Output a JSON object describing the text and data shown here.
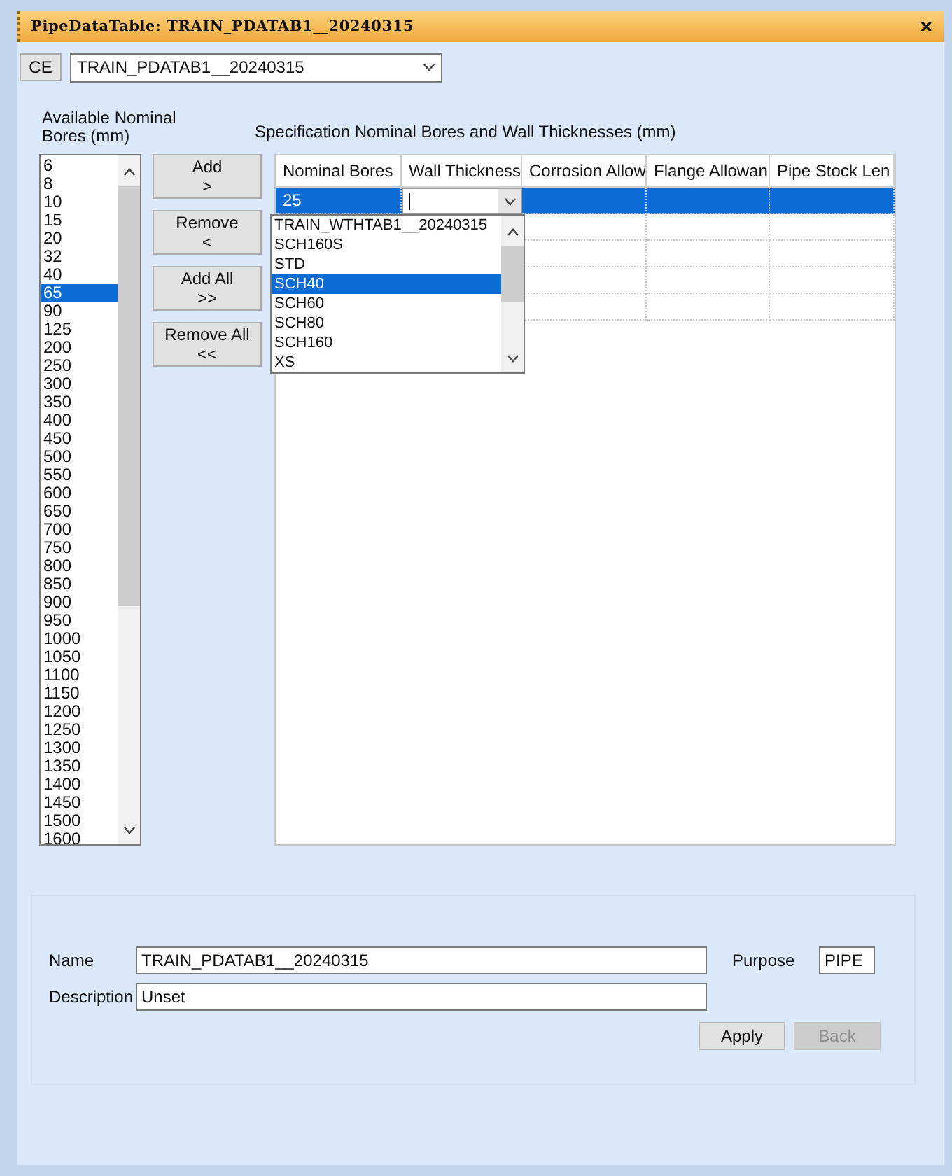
{
  "window": {
    "title": "PipeDataTable: TRAIN_PDATAB1__20240315",
    "close": "×"
  },
  "ce_button": "CE",
  "table_selector": {
    "value": "TRAIN_PDATAB1__20240315"
  },
  "available_label": "Available Nominal Bores (mm)",
  "available_bores": [
    {
      "label": "6",
      "selected": false
    },
    {
      "label": "8",
      "selected": false
    },
    {
      "label": "10",
      "selected": false
    },
    {
      "label": "15",
      "selected": false
    },
    {
      "label": "20",
      "selected": false
    },
    {
      "label": "32",
      "selected": false
    },
    {
      "label": "40",
      "selected": false
    },
    {
      "label": "65",
      "selected": true
    },
    {
      "label": "90",
      "selected": false
    },
    {
      "label": "125",
      "selected": false
    },
    {
      "label": "200",
      "selected": false
    },
    {
      "label": "250",
      "selected": false
    },
    {
      "label": "300",
      "selected": false
    },
    {
      "label": "350",
      "selected": false
    },
    {
      "label": "400",
      "selected": false
    },
    {
      "label": "450",
      "selected": false
    },
    {
      "label": "500",
      "selected": false
    },
    {
      "label": "550",
      "selected": false
    },
    {
      "label": "600",
      "selected": false
    },
    {
      "label": "650",
      "selected": false
    },
    {
      "label": "700",
      "selected": false
    },
    {
      "label": "750",
      "selected": false
    },
    {
      "label": "800",
      "selected": false
    },
    {
      "label": "850",
      "selected": false
    },
    {
      "label": "900",
      "selected": false
    },
    {
      "label": "950",
      "selected": false
    },
    {
      "label": "1000",
      "selected": false
    },
    {
      "label": "1050",
      "selected": false
    },
    {
      "label": "1100",
      "selected": false
    },
    {
      "label": "1150",
      "selected": false
    },
    {
      "label": "1200",
      "selected": false
    },
    {
      "label": "1250",
      "selected": false
    },
    {
      "label": "1300",
      "selected": false
    },
    {
      "label": "1350",
      "selected": false
    },
    {
      "label": "1400",
      "selected": false
    },
    {
      "label": "1450",
      "selected": false
    },
    {
      "label": "1500",
      "selected": false
    },
    {
      "label": "1600",
      "selected": false
    }
  ],
  "move_buttons": [
    {
      "label": "Add",
      "arrow": ">"
    },
    {
      "label": "Remove",
      "arrow": "<"
    },
    {
      "label": "Add All",
      "arrow": ">>"
    },
    {
      "label": "Remove All",
      "arrow": "<<"
    }
  ],
  "spec_label": "Specification Nominal Bores and Wall Thicknesses (mm)",
  "table": {
    "columns": [
      "Nominal Bores",
      "Wall Thickness",
      "Corrosion Allow",
      "Flange Allowan",
      "Pipe Stock Len"
    ],
    "rows": [
      {
        "nominal_bore": "25",
        "selected": true,
        "editing": true
      },
      {
        "selected": false
      },
      {
        "selected": false
      },
      {
        "selected": false
      },
      {
        "selected": false
      }
    ]
  },
  "wall_thickness_dropdown": {
    "options": [
      {
        "label": "TRAIN_WTHTAB1__20240315",
        "selected": false
      },
      {
        "label": "SCH160S",
        "selected": false
      },
      {
        "label": "STD",
        "selected": false
      },
      {
        "label": "SCH40",
        "selected": true
      },
      {
        "label": "SCH60",
        "selected": false
      },
      {
        "label": "SCH80",
        "selected": false
      },
      {
        "label": "SCH160",
        "selected": false
      },
      {
        "label": "XS",
        "selected": false
      }
    ]
  },
  "form": {
    "name_label": "Name",
    "name": "TRAIN_PDATAB1__20240315",
    "purpose_label": "Purpose",
    "purpose": "PIPE",
    "description_label": "Description",
    "description": "Unset"
  },
  "buttons": [
    {
      "label": "Apply",
      "disabled": false
    },
    {
      "label": "Back",
      "disabled": true
    }
  ]
}
